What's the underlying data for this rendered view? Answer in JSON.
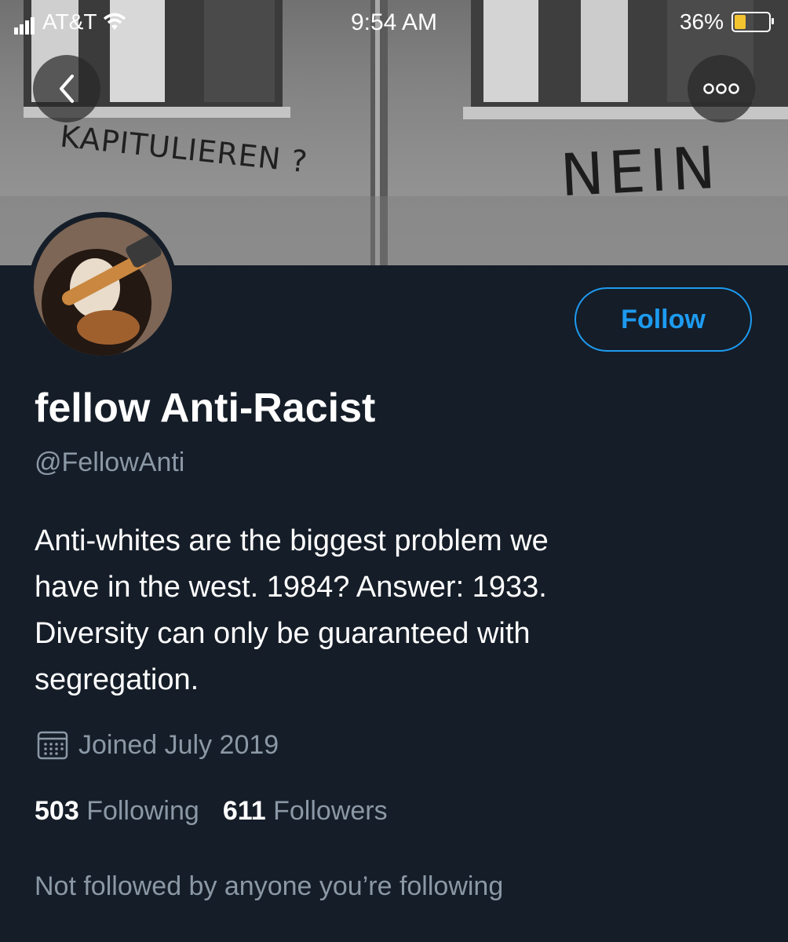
{
  "status_bar": {
    "carrier": "AT&T",
    "time": "9:54 AM",
    "battery": "36%"
  },
  "banner": {
    "graffiti_left": "KAPITULIEREN ?",
    "graffiti_right": "NEIN"
  },
  "profile": {
    "follow_label": "Follow",
    "display_name": "fellow Anti-Racist",
    "handle": "@FellowAnti",
    "bio_lines": [
      "Anti-whites are the biggest problem we",
      "have in the west. 1984? Answer: 1933.",
      "Diversity can only be guaranteed with",
      "segregation."
    ],
    "joined": "Joined July 2019",
    "following_count": "503",
    "following_label": "Following",
    "followers_count": "611",
    "followers_label": "Followers",
    "followed_by_note": "Not followed by anyone you’re following"
  },
  "colors": {
    "background": "#151d28",
    "accent": "#1d9bf0",
    "secondary_text": "#8b98a5"
  },
  "icons": [
    "signal-bars-icon",
    "wifi-icon",
    "battery-icon",
    "back-chevron-icon",
    "more-dots-icon",
    "calendar-icon"
  ]
}
